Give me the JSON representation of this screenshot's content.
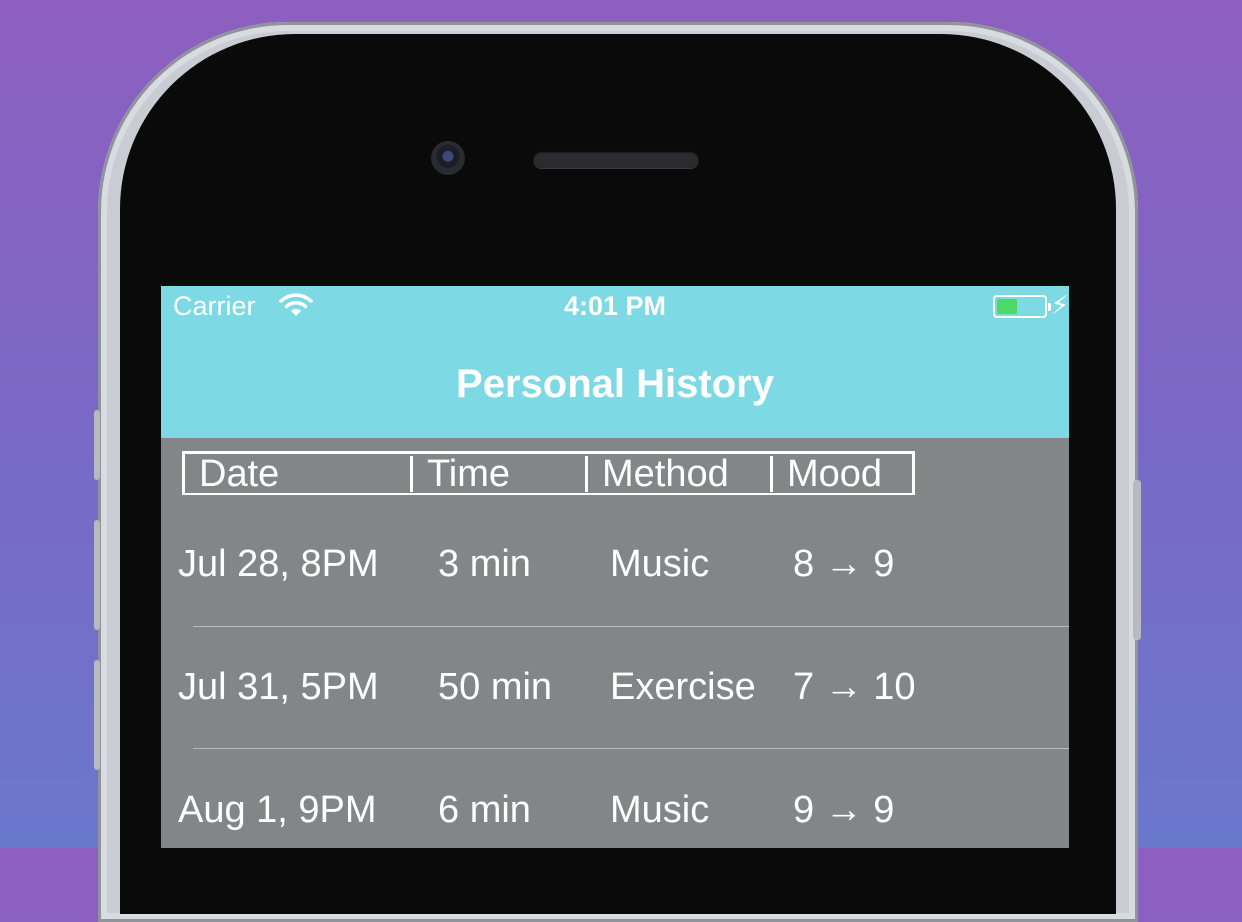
{
  "status": {
    "carrier": "Carrier",
    "time": "4:01 PM",
    "battery_color": "#4cd964"
  },
  "nav": {
    "title": "Personal History",
    "bar_color": "#7dd9e3"
  },
  "table": {
    "headers": [
      "Date",
      "Time",
      "Method",
      "Mood"
    ],
    "rows": [
      {
        "date": "Jul 28, 8PM",
        "time": "3 min",
        "method": "Music",
        "mood": "8 → 9"
      },
      {
        "date": "Jul 31, 5PM",
        "time": "50 min",
        "method": "Exercise",
        "mood": "7 → 10"
      },
      {
        "date": "Aug 1, 9PM",
        "time": "6 min",
        "method": "Music",
        "mood": "9 → 9"
      }
    ]
  },
  "icons": [
    "wifi-icon",
    "battery-icon",
    "charging-bolt-icon",
    "front-camera-icon",
    "earpiece-speaker-icon"
  ]
}
